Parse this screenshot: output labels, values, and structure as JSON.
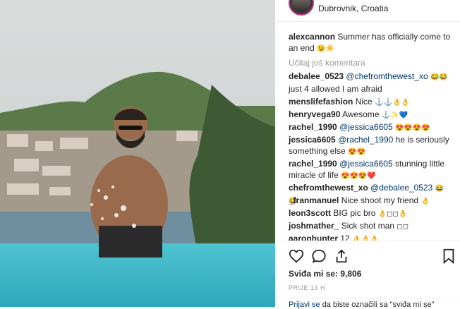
{
  "header": {
    "location": "Dubrovnik, Croatia"
  },
  "caption": {
    "user": "alexcannon",
    "text": "Summer has officially come to an end",
    "emoji": "😉☀️"
  },
  "load_more": "Učitaj još komentara",
  "comments": [
    {
      "user": "debalee_0523",
      "mention": "@chefromthewest_xo",
      "text": "just 4 allowed I am afraid",
      "emoji": "😂😂"
    },
    {
      "user": "menslifefashion",
      "mention": "",
      "text": "Nice",
      "emoji": "⚓⚓👌👌"
    },
    {
      "user": "henryvega90",
      "mention": "",
      "text": "Awesome",
      "emoji": "⚓✨💙"
    },
    {
      "user": "rachel_1990",
      "mention": "@jessica6605",
      "text": "",
      "emoji": "😍😍😍😍"
    },
    {
      "user": "jessica6605",
      "mention": "@rachel_1990",
      "text": "he is seriously something else",
      "emoji": "😍😍"
    },
    {
      "user": "rachel_1990",
      "mention": "@jessica6605",
      "text": "stunning little miracle of life",
      "emoji": "😍😍😍❤️"
    },
    {
      "user": "chefromthewest_xo",
      "mention": "@debalee_0523",
      "text": "",
      "emoji": "😂😂"
    },
    {
      "user": "_franmanuel",
      "mention": "",
      "text": "Nice shoot my friend",
      "emoji": "👌"
    },
    {
      "user": "leon3scott",
      "mention": "",
      "text": "BIG pic bro",
      "emoji": "👌◻◻👌"
    },
    {
      "user": "joshmather_",
      "mention": "",
      "text": "Sick shot man",
      "emoji": "◻◻"
    },
    {
      "user": "aaronhunter",
      "mention": "",
      "text": "12",
      "emoji": "👌👌👌"
    }
  ],
  "likes": "Sviđa mi se: 9,806",
  "time": "PRIJE 13 H",
  "login": {
    "link": "Prijavi se",
    "text": "da biste označili sa \"sviđa mi se\""
  },
  "icons": {
    "like": "heart-icon",
    "comment": "comment-icon",
    "share": "share-icon",
    "save": "bookmark-icon"
  }
}
